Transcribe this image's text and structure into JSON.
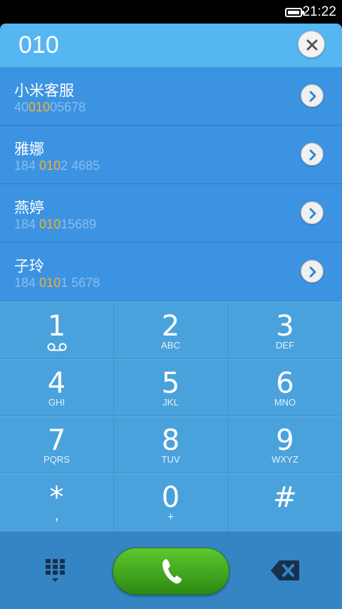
{
  "status_bar": {
    "time": "21:22"
  },
  "dialer": {
    "input_number": "010"
  },
  "results": [
    {
      "name": "小米客服",
      "number_parts": [
        "40",
        "010",
        "05678"
      ]
    },
    {
      "name": "雅娜",
      "number_parts": [
        "184 ",
        "010",
        "2 4685"
      ]
    },
    {
      "name": "燕婷",
      "number_parts": [
        "184 ",
        "010",
        "15689"
      ]
    },
    {
      "name": "子玲",
      "number_parts": [
        "184 ",
        "010",
        "1 5678"
      ]
    }
  ],
  "keypad": {
    "keys": [
      {
        "digit": "1",
        "letters": ""
      },
      {
        "digit": "2",
        "letters": "ABC"
      },
      {
        "digit": "3",
        "letters": "DEF"
      },
      {
        "digit": "4",
        "letters": "GHI"
      },
      {
        "digit": "5",
        "letters": "JKL"
      },
      {
        "digit": "6",
        "letters": "MNO"
      },
      {
        "digit": "7",
        "letters": "PQRS"
      },
      {
        "digit": "8",
        "letters": "TUV"
      },
      {
        "digit": "9",
        "letters": "WXYZ"
      },
      {
        "digit": "*",
        "letters": ","
      },
      {
        "digit": "0",
        "letters": "+"
      },
      {
        "digit": "#",
        "letters": ""
      }
    ]
  },
  "icons": {
    "battery": "battery-icon",
    "clear": "close-icon",
    "detail": "chevron-right-icon",
    "voicemail": "voicemail-icon",
    "keypad_toggle": "dialpad-icon",
    "call": "phone-icon",
    "delete": "backspace-icon"
  },
  "colors": {
    "highlight": "#f4b12d",
    "call_button": "#3fa81c",
    "panel": "#3a8fdd"
  }
}
